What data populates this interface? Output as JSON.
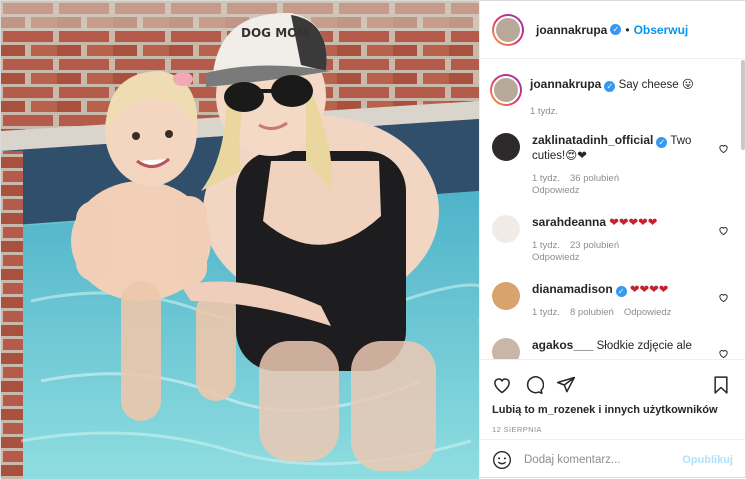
{
  "post": {
    "author": "joannakrupa",
    "follow_label": "Obserwuj",
    "caption": "Say cheese 😛",
    "caption_time": "1 tydz.",
    "photo_alt": "Mother and toddler sitting in a pool"
  },
  "cap_text": "DOG MOM",
  "comments": [
    {
      "user": "zaklinatadinh_official",
      "verified": true,
      "text": "Two cuties!😍❤",
      "time": "1 tydz.",
      "likes": "36 polubień",
      "reply": "Odpowiedz"
    },
    {
      "user": "sarahdeanna",
      "verified": false,
      "text": "❤❤❤❤❤",
      "time": "1 tydz.",
      "likes": "23 polubień",
      "reply": "Odpowiedz"
    },
    {
      "user": "dianamadison",
      "verified": true,
      "text": "❤❤❤❤",
      "time": "1 tydz.",
      "likes": "8 polubień",
      "reply": "Odpowiedz"
    },
    {
      "user": "agakos___",
      "verified": false,
      "text": "Słodkie zdjęcie ale",
      "time": "",
      "likes": "",
      "reply": ""
    }
  ],
  "likes_text": "Lubią to m_rozenek i innych użytkowników",
  "date_text": "12 SIERPNIA",
  "comment_input": {
    "placeholder": "Dodaj komentarz...",
    "value": ""
  },
  "publish_label": "Opublikuj",
  "icons": {
    "like": "heart-icon",
    "comment": "comment-icon",
    "share": "share-icon",
    "save": "bookmark-icon",
    "emoji": "emoji-icon"
  },
  "colors": {
    "accent": "#0095f6",
    "verified": "#3897f0",
    "border": "#dbdbdb",
    "muted": "#8e8e8e",
    "publish_disabled": "#b2dffc"
  }
}
